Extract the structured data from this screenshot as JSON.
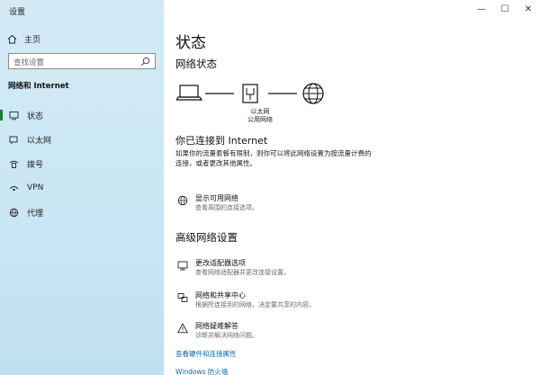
{
  "app": {
    "title": "设置"
  },
  "window": {
    "minimize": "—",
    "maximize": "☐",
    "close": "✕"
  },
  "sidebar": {
    "home_label": "主页",
    "search_placeholder": "查找设置",
    "section_title": "网络和 Internet",
    "items": [
      {
        "label": "状态",
        "icon": "status-icon",
        "active": true
      },
      {
        "label": "以太网",
        "icon": "ethernet-icon"
      },
      {
        "label": "拨号",
        "icon": "dialup-icon"
      },
      {
        "label": "VPN",
        "icon": "vpn-icon"
      },
      {
        "label": "代理",
        "icon": "proxy-icon"
      }
    ]
  },
  "main": {
    "title": "状态",
    "network_status_heading": "网络状态",
    "diagram": {
      "label_line1": "以太网",
      "label_line2": "公用网络"
    },
    "connected_title": "你已连接到 Internet",
    "connected_desc_line1": "如果你的流量套餐有限制，则你可以将此网络设置为按流量计费的",
    "connected_desc_line2": "连接，或者更改其他属性。",
    "show_networks": {
      "title": "显示可用网络",
      "subtitle": "查看周围的连接选项。"
    },
    "advanced_heading": "高级网络设置",
    "adapter": {
      "title": "更改适配器选项",
      "subtitle": "查看网络适配器并更改连接设置。"
    },
    "sharing": {
      "title": "网络和共享中心",
      "subtitle": "根据所连接到的网络，决定要共享的内容。"
    },
    "troubleshoot": {
      "title": "网络疑难解答",
      "subtitle": "诊断并解决网络问题。"
    },
    "hw_props_link": "查看硬件和连接属性",
    "firewall_link": "Windows 防火墙"
  },
  "colors": {
    "accent": "#0b6aa8",
    "sidebar_bg": "#cde8f5",
    "active_bar": "#1a7a3a"
  }
}
